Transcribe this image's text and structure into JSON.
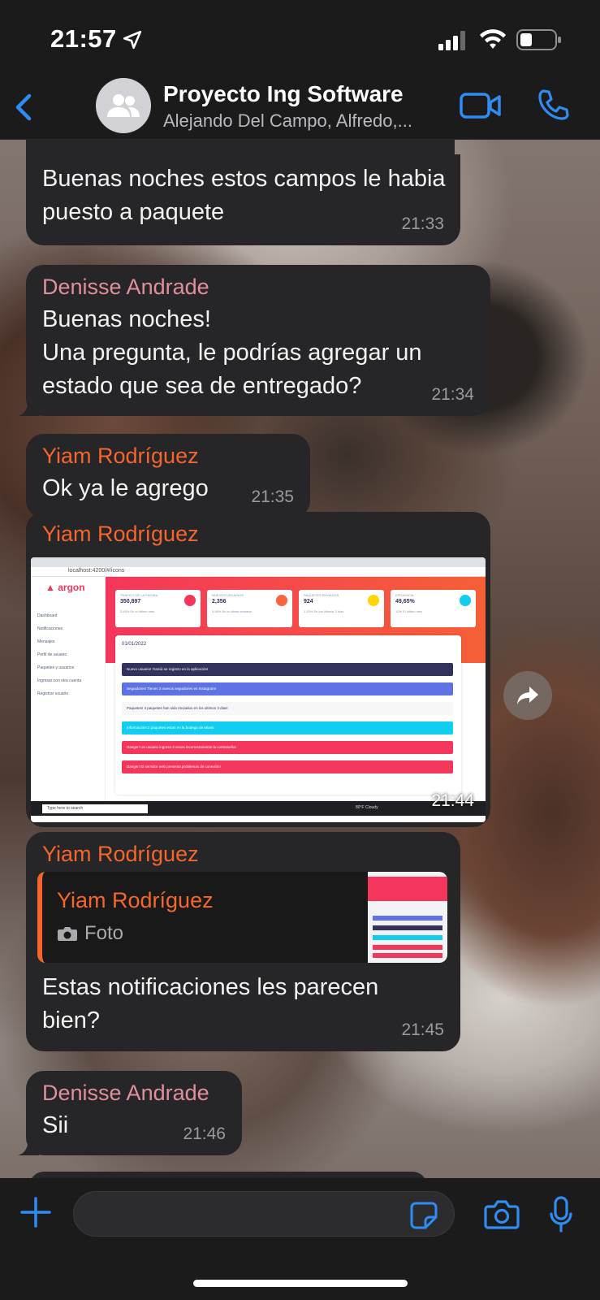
{
  "status": {
    "time": "21:57"
  },
  "header": {
    "title": "Proyecto Ing Software",
    "subtitle": "Alejando Del Campo, Alfredo,..."
  },
  "messages": [
    {
      "text": "Buenas noches estos campos le habia puesto a paquete",
      "time": "21:33"
    },
    {
      "sender": "Denisse Andrade",
      "text": "Buenas noches!\nUna pregunta, le podrías agregar un estado que sea de entregado?",
      "time": "21:34"
    },
    {
      "sender": "Yiam Rodríguez",
      "text": "Ok ya le agrego",
      "time": "21:35"
    },
    {
      "sender": "Yiam Rodríguez",
      "time": "21:44"
    },
    {
      "sender": "Yiam Rodríguez",
      "quote_name": "Yiam Rodríguez",
      "quote_label": "Foto",
      "text": "Estas notificaciones les parecen bien?",
      "time": "21:45"
    },
    {
      "sender": "Denisse Andrade",
      "text": "Sii",
      "time": "21:46"
    }
  ],
  "shot": {
    "brand": "argon",
    "url": "localhost:4200/#/icons",
    "sidebar": [
      "Dashboard",
      "Notificaciones",
      "Mensajes",
      "Perfil de usuario",
      "Paquetes y usuarios",
      "Ingresar con otra cuenta",
      "Registrar usuario"
    ],
    "cards": [
      {
        "label": "TRÁFICO DE LA PÁGINA",
        "value": "350,897",
        "note": "3.48% En el último mes",
        "color": "#f5365c"
      },
      {
        "label": "NUEVOS USUARIOS",
        "value": "2,356",
        "note": "3.48% En la última semana",
        "color": "#fb6340"
      },
      {
        "label": "PAQUETES ENVIADOS",
        "value": "924",
        "note": "1.10% En los últimos 3 días",
        "color": "#ffd600"
      },
      {
        "label": "EFICIENCIA",
        "value": "49,65%",
        "note": "12% El último mes",
        "color": "#11cdef"
      }
    ],
    "date": "01/01/2022",
    "alerts": [
      {
        "text": "Nuevo usuario! Yiamiii se registro en la aplicación!",
        "color": "#32325d"
      },
      {
        "text": "Seguidores! Tienes 3 nuevos seguidores en Instagram!",
        "color": "#5e72e4"
      },
      {
        "text": "Paquetes! 4 paquetes han sido enviados en los ultimos 3 dias!",
        "color": "#f7f7f7"
      },
      {
        "text": "Información! 2 paquetes estan en la bodega de Miami",
        "color": "#11cdef"
      },
      {
        "text": "Danger! Un usuario ingreso 3 veces incorrectamente la contraseña!",
        "color": "#f5365c"
      },
      {
        "text": "Danger! El servidor web presenta problemas de conexión!",
        "color": "#f5365c"
      }
    ],
    "taskbar_search": "Type here to search",
    "weather": "80°F Cloudy"
  },
  "composer": {
    "placeholder": ""
  },
  "colors": {
    "accent": "#2f8cf2",
    "sender_orange": "#f4662c",
    "sender_pink": "#e0909c"
  }
}
